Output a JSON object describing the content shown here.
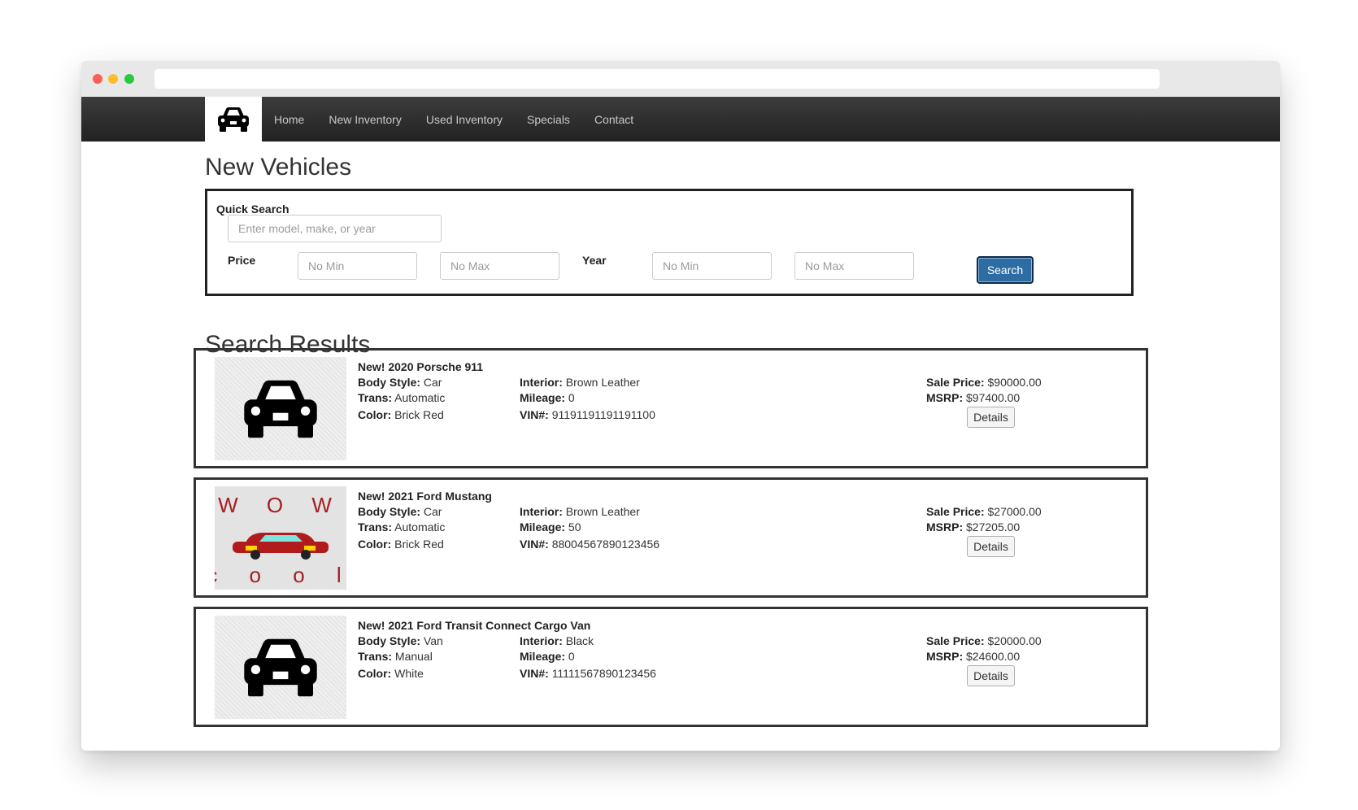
{
  "nav": {
    "links": [
      "Home",
      "New Inventory",
      "Used Inventory",
      "Specials",
      "Contact"
    ]
  },
  "page": {
    "title": "New Vehicles"
  },
  "quick_search": {
    "label": "Quick Search",
    "placeholder": "Enter model, make, or year",
    "price_label": "Price",
    "year_label": "Year",
    "min_placeholder": "No Min",
    "max_placeholder": "No Max",
    "search_button": "Search"
  },
  "results": {
    "title": "Search Results",
    "labels": {
      "body_style": "Body Style:",
      "trans": "Trans:",
      "color": "Color:",
      "interior": "Interior:",
      "mileage": "Mileage:",
      "vin": "VIN#:",
      "sale_price": "Sale Price:",
      "msrp": "MSRP:",
      "details": "Details"
    },
    "items": [
      {
        "title": "New! 2020 Porsche 911",
        "body_style": "Car",
        "trans": "Automatic",
        "color": "Brick Red",
        "interior": "Brown Leather",
        "mileage": "0",
        "vin": "91191191191191100",
        "sale_price": "$90000.00",
        "msrp": "$97400.00",
        "image": "car-icon"
      },
      {
        "title": "New! 2021 Ford Mustang",
        "body_style": "Car",
        "trans": "Automatic",
        "color": "Brick Red",
        "interior": "Brown Leather",
        "mileage": "50",
        "vin": "88004567890123456",
        "sale_price": "$27000.00",
        "msrp": "$27205.00",
        "image": "wow-cool-car",
        "image_text": {
          "top": "W O W",
          "bottom": "c o o l"
        }
      },
      {
        "title": "New! 2021 Ford Transit Connect Cargo Van",
        "body_style": "Van",
        "trans": "Manual",
        "color": "White",
        "interior": "Black",
        "mileage": "0",
        "vin": "11111567890123456",
        "sale_price": "$20000.00",
        "msrp": "$24600.00",
        "image": "car-icon"
      }
    ]
  },
  "colors": {
    "navbar": "#2b2b2b",
    "search_button": "#2e6da4",
    "wow_text": "#a32020"
  }
}
